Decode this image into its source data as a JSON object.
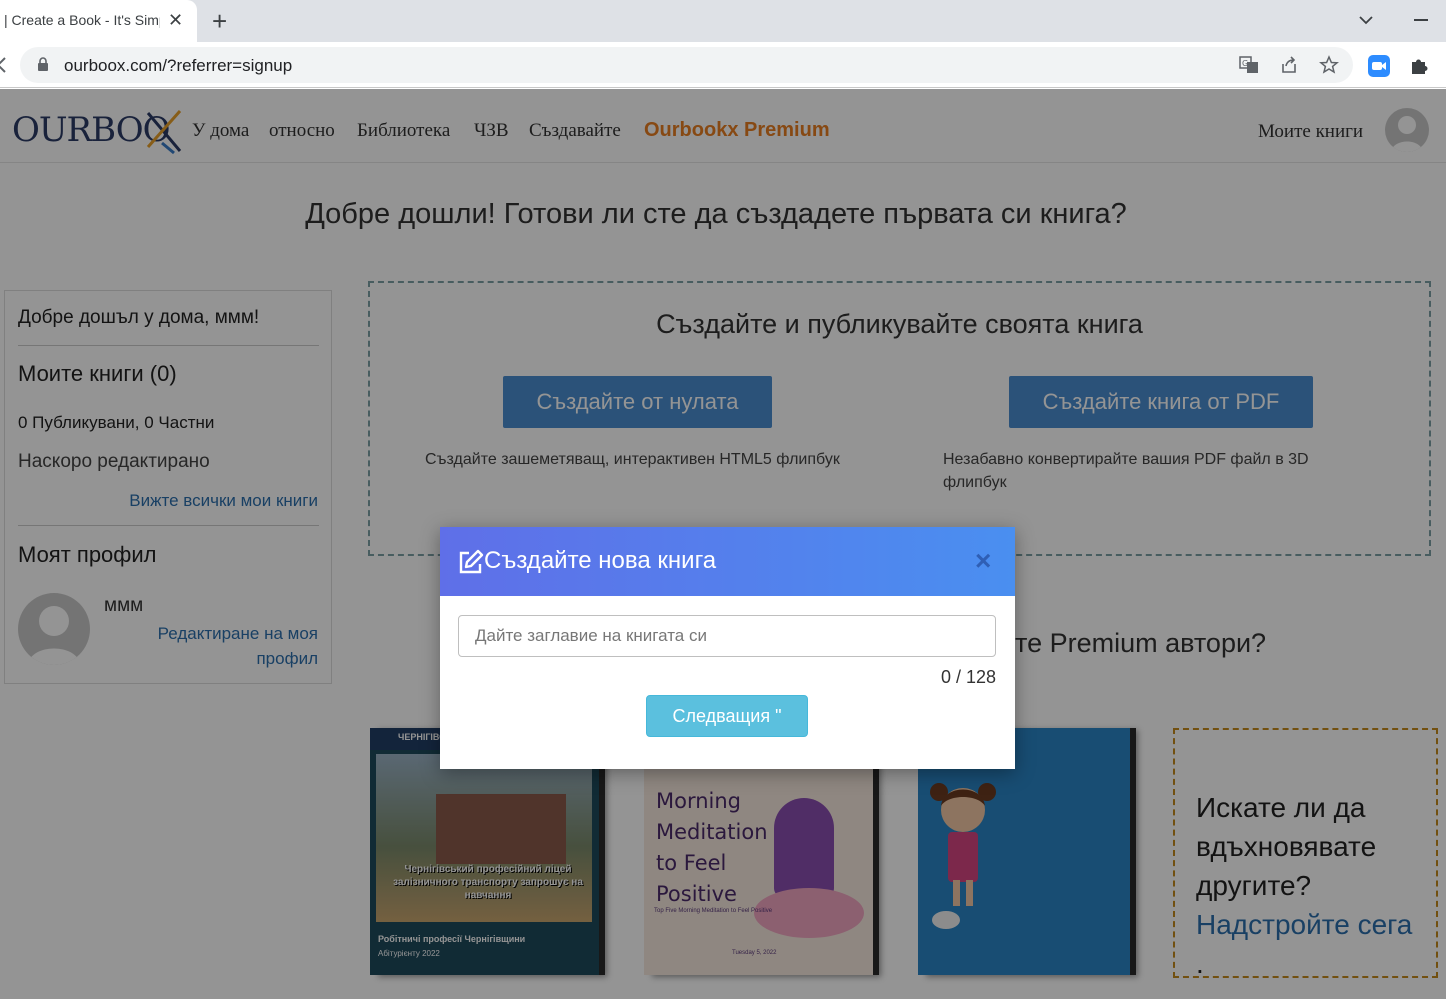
{
  "browser": {
    "tab_title": "| Create a Book - It's Simple",
    "tab_close": "✕",
    "new_tab": "+",
    "url": "ourboox.com/?referrer=signup"
  },
  "header": {
    "logo_text": "OURBOOX",
    "nav": [
      "У дома",
      "относно",
      "Библиотека",
      "ЧЗВ",
      "Създавайте"
    ],
    "premium": "Ourbookx Premium",
    "my_books": "Моите книги"
  },
  "main": {
    "welcome": "Добре дошли! Готови ли сте да създадете първата си книга?",
    "sidebar": {
      "greeting": "Добре дошъл у дома, ммм!",
      "my_books_title": "Моите книги (0)",
      "stats": "0 Публикувани, 0 Частни",
      "recently_edited": "Наскоро редактирано",
      "view_all": "Вижте всички мои книги",
      "profile_title": "Моят профил",
      "username": "ммм",
      "edit_profile": "Редактиране на моя профил"
    },
    "create": {
      "title": "Създайте и публикувайте своята книга",
      "scratch_button": "Създайте от нулата",
      "scratch_desc": "Създайте зашеметяващ, интерактивен HTML5 флипбук",
      "pdf_button": "Създайте книга от PDF",
      "pdf_desc": "Незабавно конвертирайте вашия PDF файл в 3D флипбук"
    },
    "premium_question": "те Premium автори?",
    "books": [
      {
        "title_top": "ЧЕРНІГІВСЬ ЗАЛІЗН",
        "caption": "Чернігівський професійний ліцей залізничного транспорту запрошує на навчання",
        "footer": "Робітничі професії Чернігівщини",
        "footer2": "Абітурієнту 2022"
      },
      {
        "title": "Morning Meditation to Feel Positive",
        "subtitle": "Top Five Morning Meditation to Feel Positive",
        "footer": "Tuesday 5, 2022"
      },
      {
        "title": ""
      }
    ],
    "promo": {
      "question": "Искате ли да вдъхновявате другите?",
      "link": "Надстройте сега",
      "tail": "."
    }
  },
  "modal": {
    "title": "Създайте нова книга",
    "close": "×",
    "input_placeholder": "Дайте заглавие на книгата си",
    "input_value": "",
    "counter": "0 / 128",
    "next_button": "Следващия \""
  },
  "colors": {
    "modal_gradient_start": "#5f6fe8",
    "modal_gradient_end": "#4a8ff0",
    "primary_button": "#4a8ed1",
    "next_button": "#5bc0de",
    "premium": "#e87e22",
    "link": "#2c6fad"
  }
}
